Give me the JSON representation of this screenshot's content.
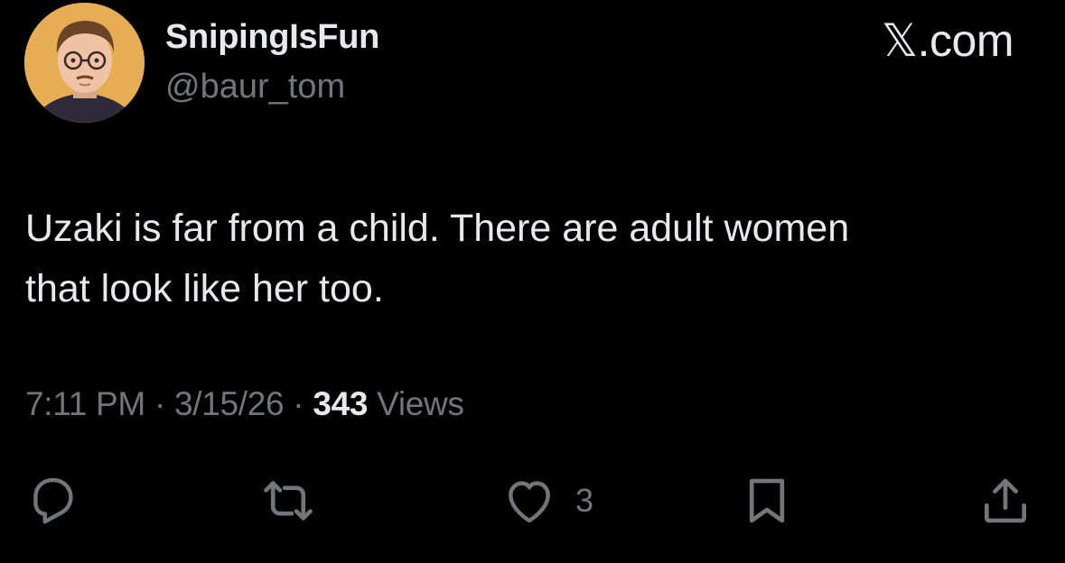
{
  "author": {
    "display_name": "SnipingIsFun",
    "handle": "@baur_tom",
    "avatar": "cartoon-man-with-glasses-avatar"
  },
  "brand": "𝕏.com",
  "tweet": {
    "text_line1": "Uzaki is far from a child. There are adult women",
    "text_line2": "that look like her too."
  },
  "meta": {
    "time": "7:11 PM",
    "separator": "·",
    "date": "3/15/26",
    "views_count": "343",
    "views_label": "Views"
  },
  "actions": {
    "reply_icon": "reply-icon",
    "repost_icon": "repost-icon",
    "like_icon": "heart-icon",
    "like_count": "3",
    "bookmark_icon": "bookmark-icon",
    "share_icon": "share-icon"
  },
  "colors": {
    "background": "#000000",
    "primary_text": "#e7e9ea",
    "secondary_text": "#71767b"
  }
}
